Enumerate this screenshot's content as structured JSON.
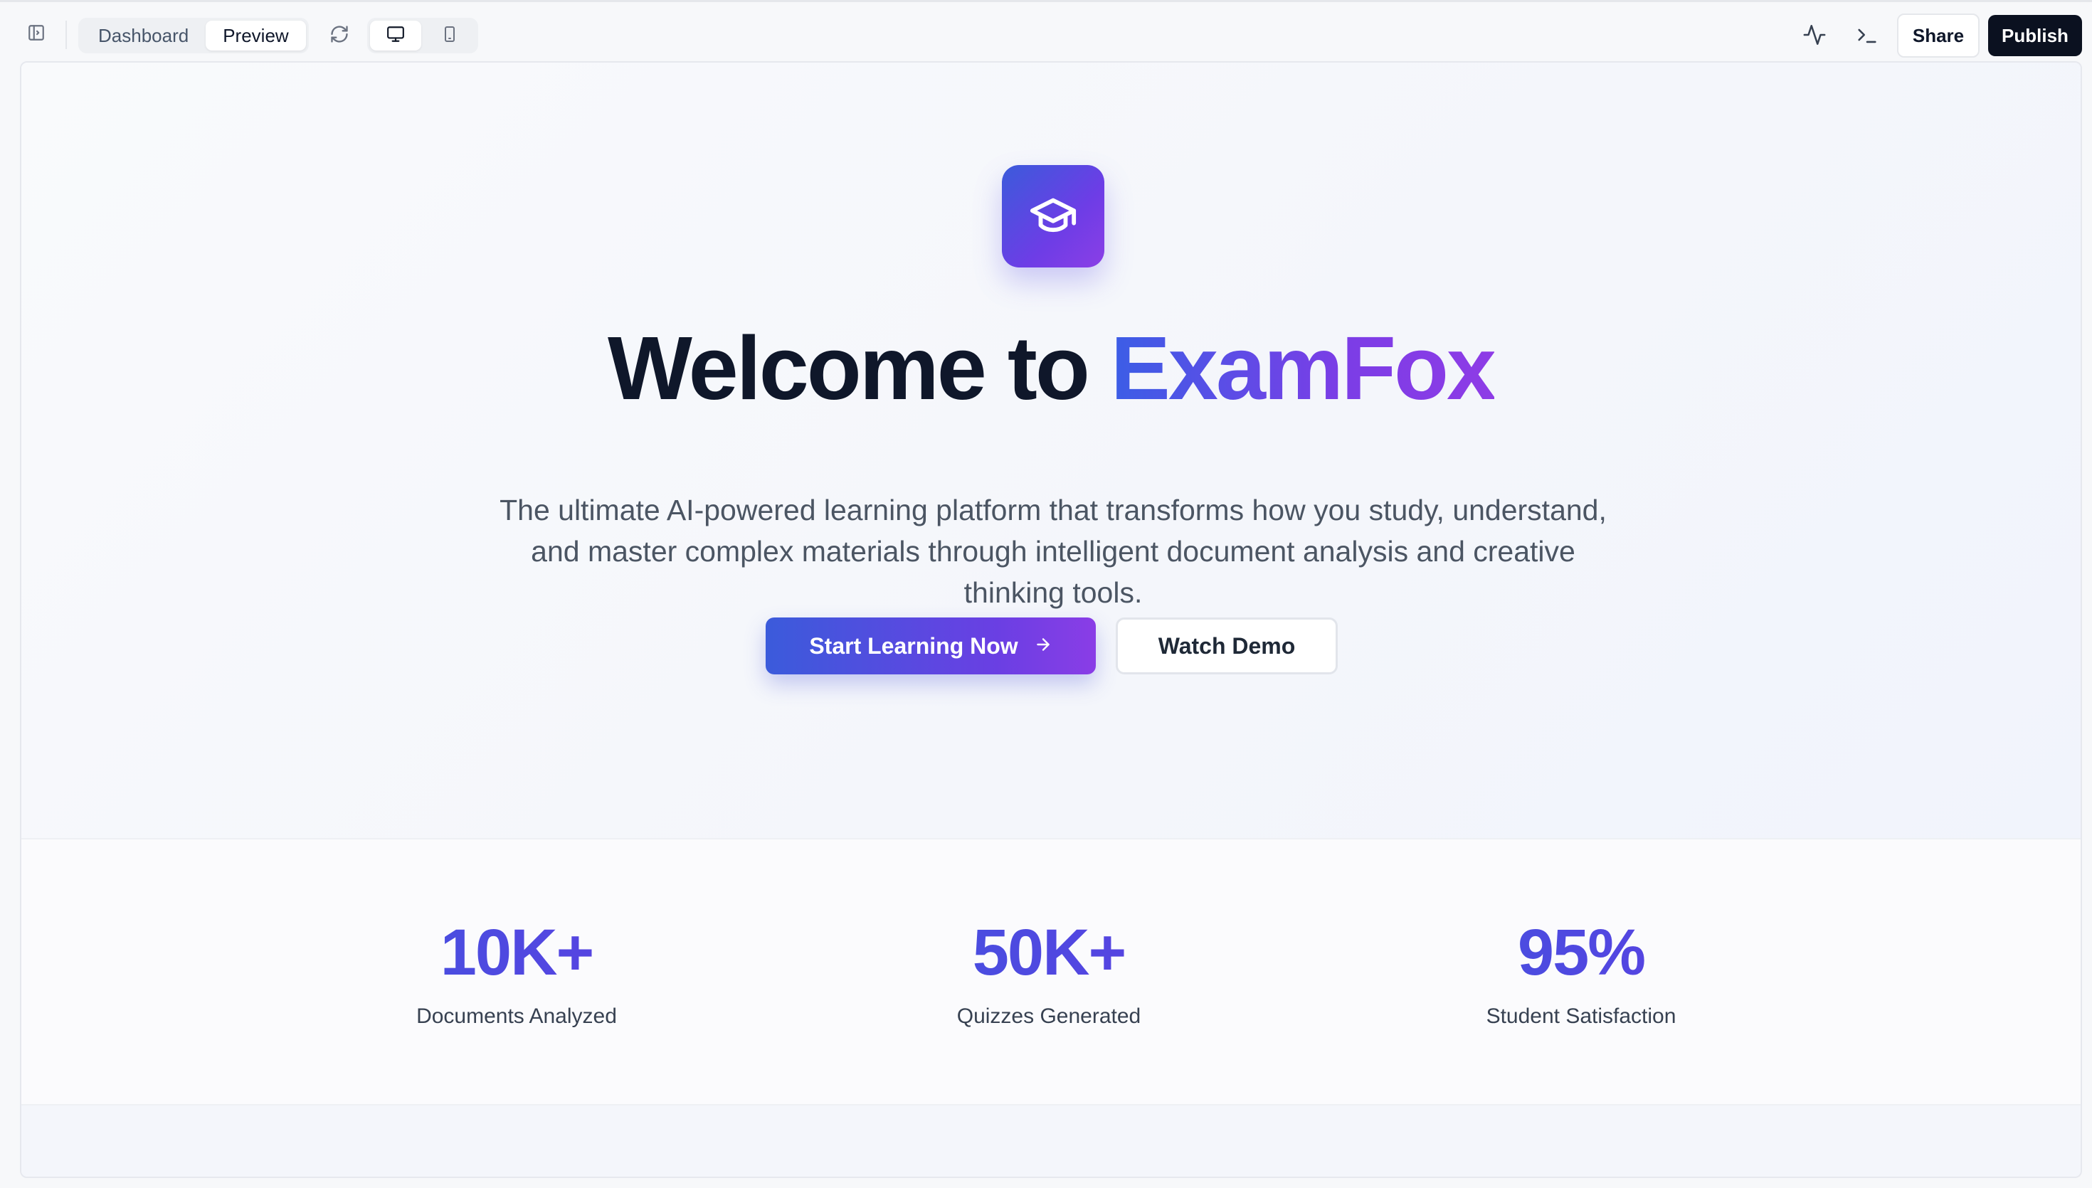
{
  "toolbar": {
    "tabs": [
      {
        "label": "Dashboard",
        "active": false
      },
      {
        "label": "Preview",
        "active": true
      }
    ],
    "share_label": "Share",
    "publish_label": "Publish",
    "icons": {
      "sidebar_toggle": "sidebar-panel-icon",
      "refresh": "refresh-icon",
      "desktop": "monitor-icon",
      "mobile": "smartphone-icon",
      "activity": "activity-icon",
      "terminal": "terminal-icon"
    }
  },
  "hero": {
    "logo_icon": "graduation-cap-icon",
    "title_prefix": "Welcome to ",
    "title_brand": "ExamFox",
    "subtitle": "The ultimate AI-powered learning platform that transforms how you study, understand, and master complex materials through intelligent document analysis and creative thinking tools.",
    "primary_cta": "Start Learning Now",
    "primary_cta_icon": "arrow-right-icon",
    "secondary_cta": "Watch Demo"
  },
  "stats": [
    {
      "value": "10K+",
      "label": "Documents Analyzed"
    },
    {
      "value": "50K+",
      "label": "Quizzes Generated"
    },
    {
      "value": "95%",
      "label": "Student Satisfaction"
    }
  ],
  "colors": {
    "brand_start": "#3b5bdb",
    "brand_end": "#8b3ee6",
    "stat_color": "#4f46e5",
    "publish_bg": "#0b1120"
  }
}
